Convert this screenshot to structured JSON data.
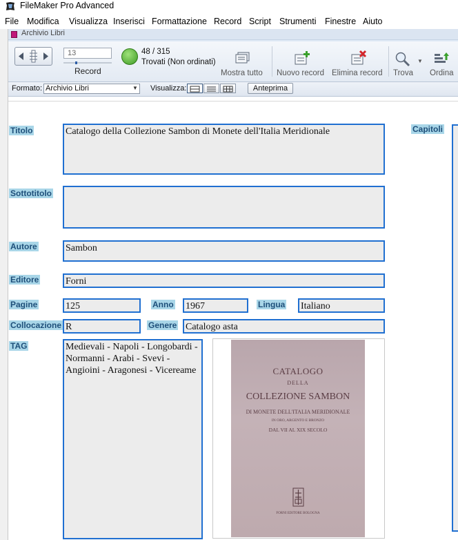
{
  "app": {
    "title": "FileMaker Pro Advanced"
  },
  "menu": [
    "File",
    "Modifica",
    "Visualizza",
    "Inserisci",
    "Formattazione",
    "Record",
    "Script",
    "Strumenti",
    "Finestre",
    "Aiuto"
  ],
  "window": {
    "title": "Archivio Libri"
  },
  "toolbar": {
    "record_value": "13",
    "record_label": "Record",
    "found_count": "48 / 315",
    "found_status": "Trovati (Non ordinati)",
    "show_all": "Mostra tutto",
    "new_record": "Nuovo record",
    "delete_record": "Elimina record",
    "find": "Trova",
    "sort": "Ordina"
  },
  "layoutbar": {
    "format_label": "Formato:",
    "format_value": "Archivio Libri",
    "view_label": "Visualizza:",
    "preview": "Anteprima"
  },
  "labels": {
    "title": "Titolo",
    "subtitle": "Sottotitolo",
    "author": "Autore",
    "publisher": "Editore",
    "pages": "Pagine",
    "year": "Anno",
    "language": "Lingua",
    "location": "Collocazione",
    "genre": "Genere",
    "tag": "TAG",
    "chapters": "Capitoli"
  },
  "record": {
    "title": "Catalogo della Collezione Sambon di Monete dell'Italia Meridionale",
    "subtitle": "",
    "author": "Sambon",
    "publisher": "Forni",
    "pages": "125",
    "year": "1967",
    "language": "Italiano",
    "location": "R",
    "genre": "Catalogo asta",
    "tag": "Medievali - Napoli - Longobardi - Normanni - Arabi - Svevi - Angioini - Aragonesi - Vicereame"
  },
  "cover": {
    "line1": "CATALOGO",
    "line2": "DELLA",
    "line3": "COLLEZIONE SAMBON",
    "line4": "DI MONETE DELL'ITALIA MERIDIONALE",
    "line5": "IN ORO, ARGENTO E BRONZO",
    "line6": "DAL VII AL XIX SECOLO",
    "publisher": "FORNI EDITORE BOLOGNA"
  },
  "colors": {
    "field_border": "#1f6fd1",
    "label_bg": "#a9d6e8",
    "field_bg": "#ececec"
  }
}
